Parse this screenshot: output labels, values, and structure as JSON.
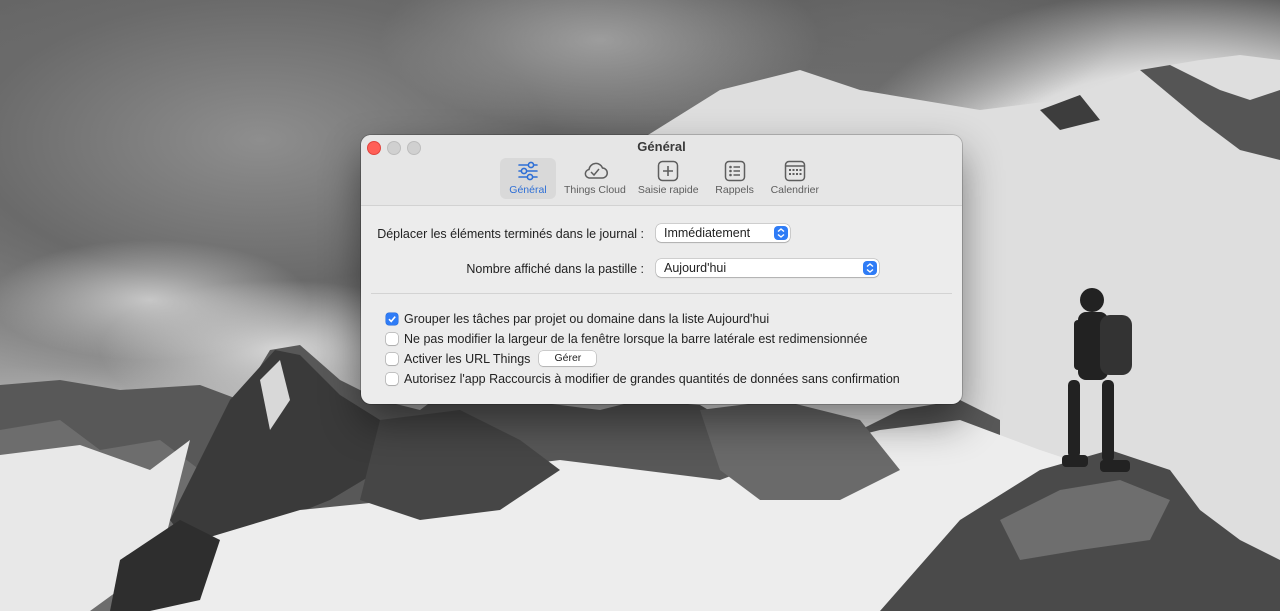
{
  "window": {
    "title": "Général"
  },
  "tabs": [
    {
      "label": "Général",
      "icon": "sliders-icon",
      "active": true
    },
    {
      "label": "Things Cloud",
      "icon": "cloud-check-icon",
      "active": false
    },
    {
      "label": "Saisie rapide",
      "icon": "plus-square-icon",
      "active": false
    },
    {
      "label": "Rappels",
      "icon": "list-icon",
      "active": false
    },
    {
      "label": "Calendrier",
      "icon": "calendar-icon",
      "active": false
    }
  ],
  "settings": {
    "logbook_label": "Déplacer les éléments terminés dans le journal :",
    "logbook_value": "Immédiatement",
    "badge_label": "Nombre affiché dans la pastille :",
    "badge_value": "Aujourd'hui"
  },
  "checkboxes": [
    {
      "label": "Grouper les tâches par projet ou domaine dans la liste Aujourd'hui",
      "checked": true
    },
    {
      "label": "Ne pas modifier la largeur de la fenêtre lorsque la barre latérale est redimensionnée",
      "checked": false
    },
    {
      "label": "Activer les URL Things",
      "checked": false
    },
    {
      "label": "Autorisez l'app Raccourcis à modifier de grandes quantités de données sans confirmation",
      "checked": false
    }
  ],
  "manage_button": "Gérer",
  "colors": {
    "accent": "#2f7cf6",
    "close": "#ff5f57"
  }
}
